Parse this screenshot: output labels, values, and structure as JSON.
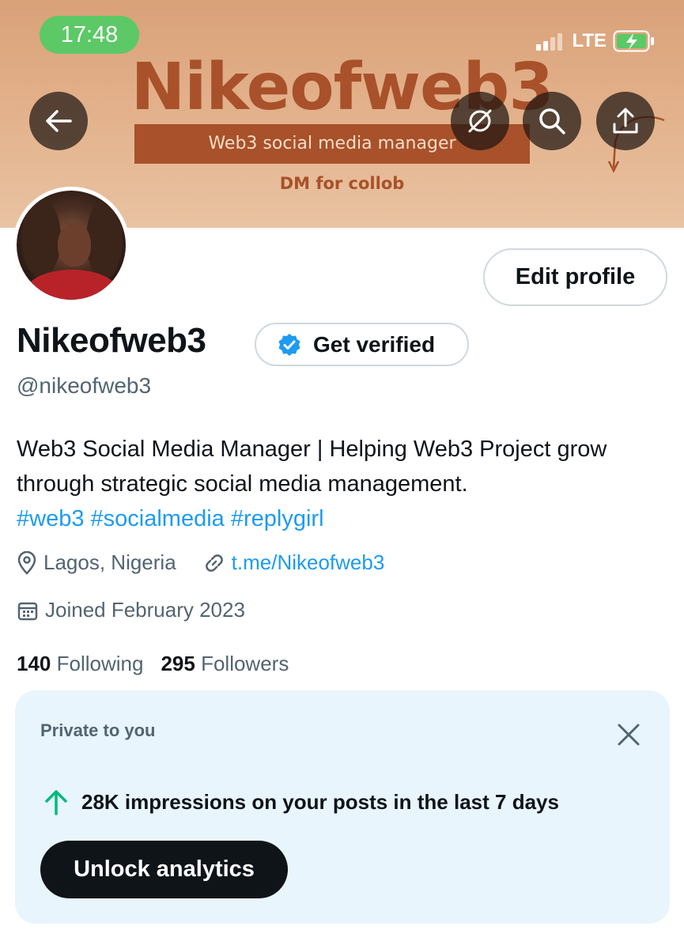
{
  "status_bar": {
    "time": "17:48",
    "network": "LTE"
  },
  "banner": {
    "title": "Nikeofweb3",
    "subtitle": "Web3 social media manager",
    "tagline": "DM for collob"
  },
  "header_actions": {
    "back_icon": "arrow-left",
    "circle_icon": "circle-slash",
    "search_icon": "search",
    "share_icon": "share-upload"
  },
  "profile": {
    "edit_label": "Edit profile",
    "display_name": "Nikeofweb3",
    "verify_label": "Get verified",
    "handle": "@nikeofweb3",
    "bio_text": "Web3 Social Media Manager | Helping Web3 Project grow through strategic social media management.",
    "hashtags": [
      "#web3",
      "#socialmedia",
      "#replygirl"
    ],
    "location": "Lagos, Nigeria",
    "link": "t.me/Nikeofweb3",
    "joined": "Joined February 2023",
    "following_count": "140",
    "following_label": "Following",
    "followers_count": "295",
    "followers_label": "Followers"
  },
  "private_card": {
    "label": "Private to you",
    "impressions": "28K impressions on your posts in the last 7 days",
    "button_label": "Unlock analytics"
  },
  "colors": {
    "accent": "#1d9bf0",
    "banner_text": "#a8512a",
    "time_pill": "#5cc866",
    "card_bg": "#e8f5fd",
    "trend_up": "#00ba7c"
  }
}
